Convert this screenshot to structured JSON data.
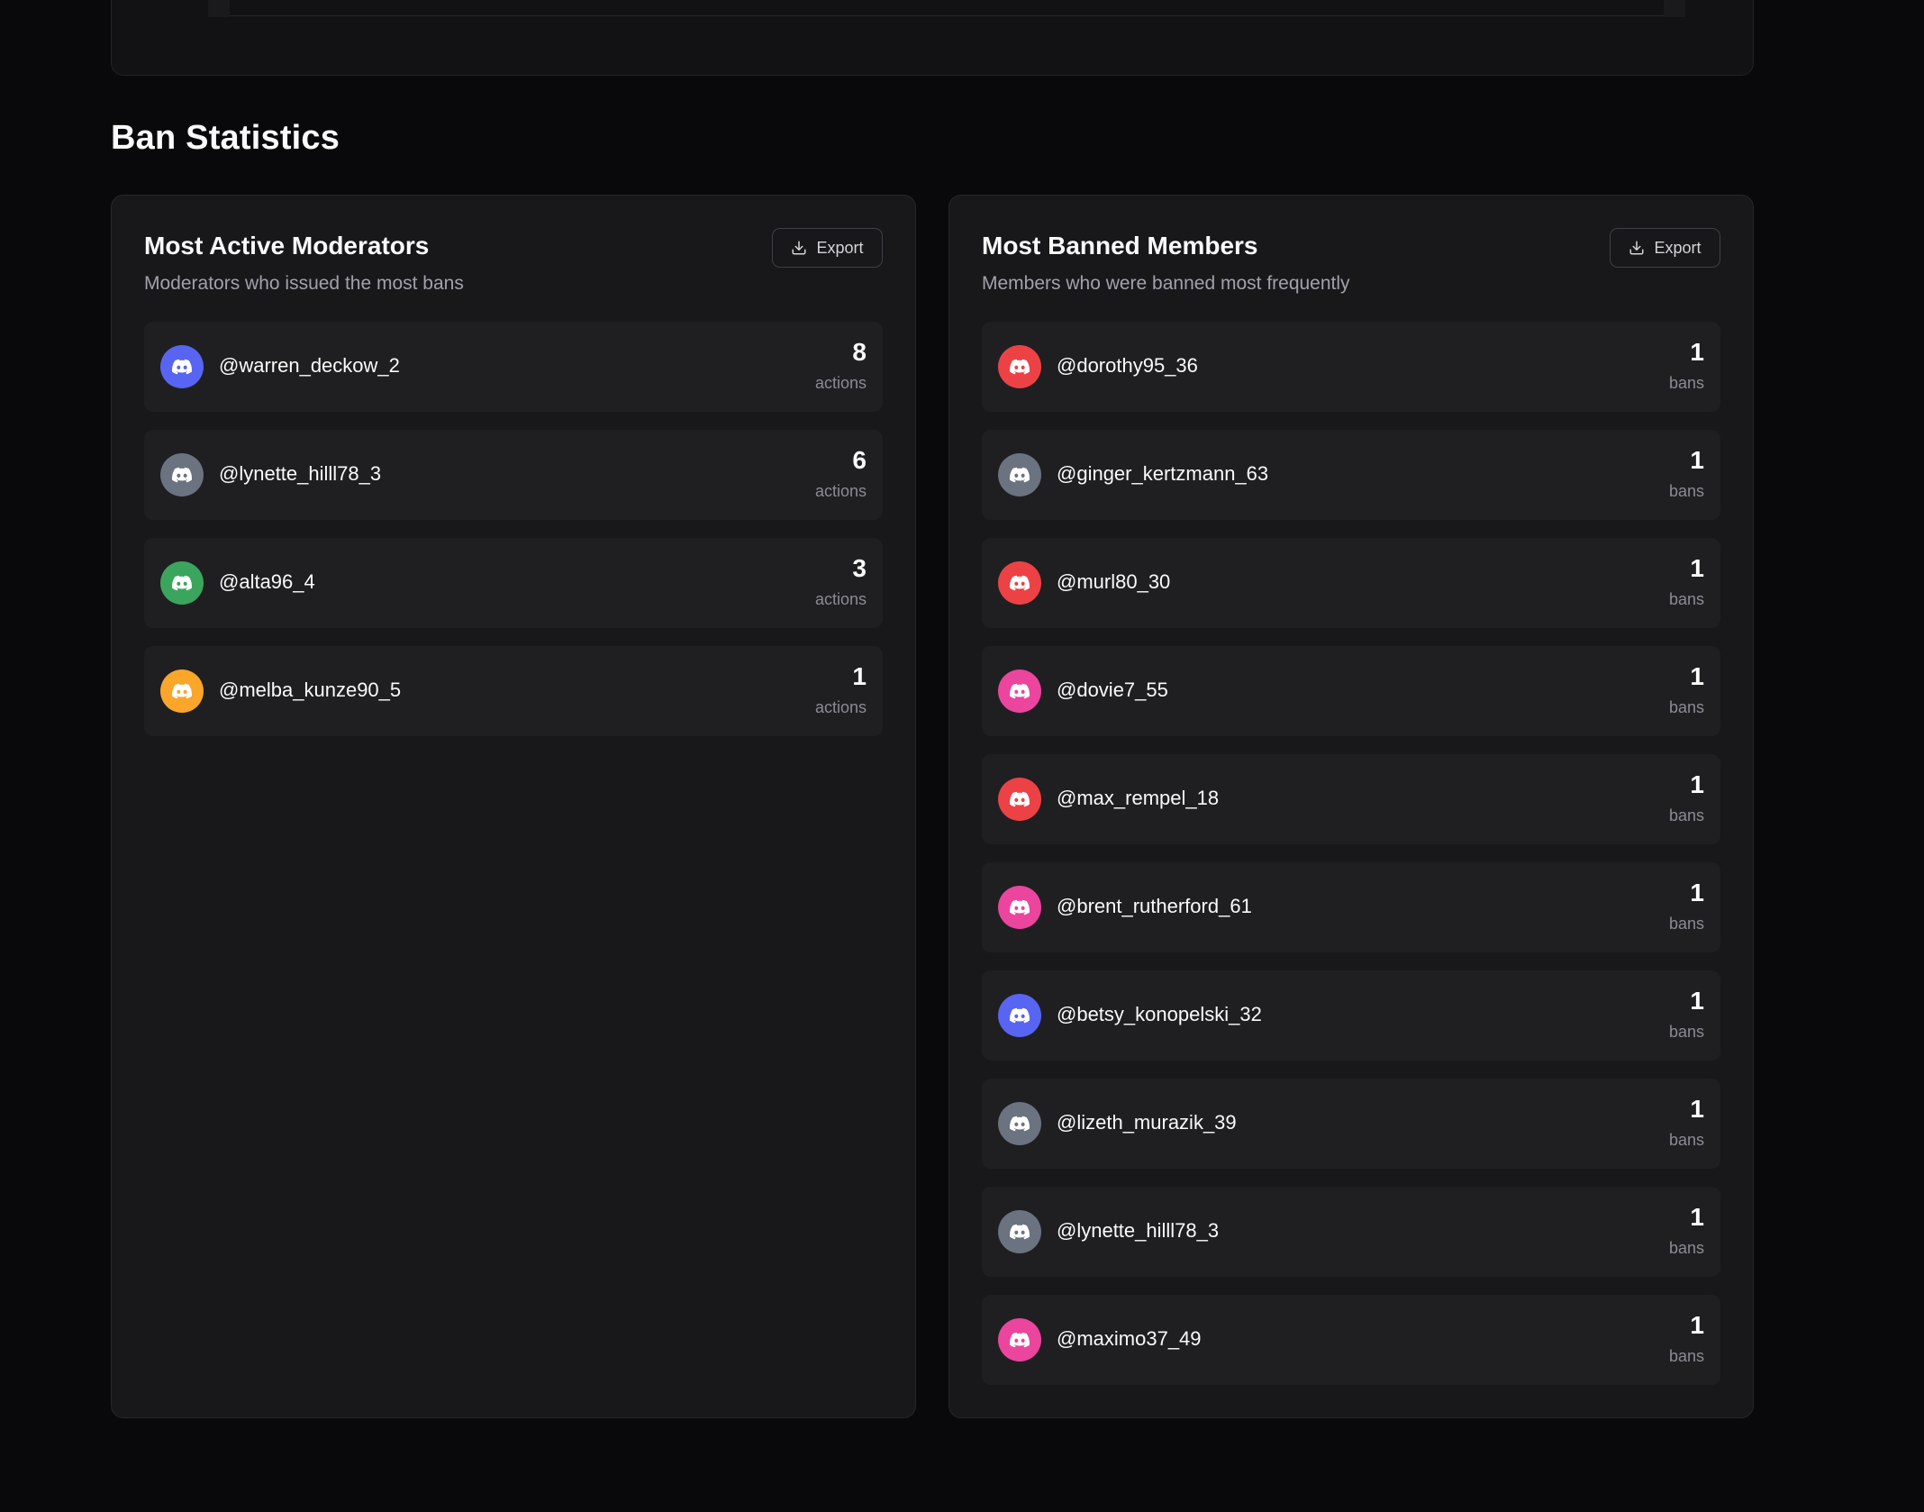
{
  "section": {
    "title": "Ban Statistics"
  },
  "moderators": {
    "title": "Most Active Moderators",
    "subtitle": "Moderators who issued the most bans",
    "export_label": "Export",
    "items": [
      {
        "username": "@warren_deckow_2",
        "count": "8",
        "unit": "actions",
        "avatar_color": "#5865f2"
      },
      {
        "username": "@lynette_hilll78_3",
        "count": "6",
        "unit": "actions",
        "avatar_color": "#6b7280"
      },
      {
        "username": "@alta96_4",
        "count": "3",
        "unit": "actions",
        "avatar_color": "#3ba55d"
      },
      {
        "username": "@melba_kunze90_5",
        "count": "1",
        "unit": "actions",
        "avatar_color": "#f9a62b"
      }
    ]
  },
  "banned": {
    "title": "Most Banned Members",
    "subtitle": "Members who were banned most frequently",
    "export_label": "Export",
    "items": [
      {
        "username": "@dorothy95_36",
        "count": "1",
        "unit": "bans",
        "avatar_color": "#ed4245"
      },
      {
        "username": "@ginger_kertzmann_63",
        "count": "1",
        "unit": "bans",
        "avatar_color": "#6b7280"
      },
      {
        "username": "@murl80_30",
        "count": "1",
        "unit": "bans",
        "avatar_color": "#ed4245"
      },
      {
        "username": "@dovie7_55",
        "count": "1",
        "unit": "bans",
        "avatar_color": "#eb459e"
      },
      {
        "username": "@max_rempel_18",
        "count": "1",
        "unit": "bans",
        "avatar_color": "#ed4245"
      },
      {
        "username": "@brent_rutherford_61",
        "count": "1",
        "unit": "bans",
        "avatar_color": "#eb459e"
      },
      {
        "username": "@betsy_konopelski_32",
        "count": "1",
        "unit": "bans",
        "avatar_color": "#5865f2"
      },
      {
        "username": "@lizeth_murazik_39",
        "count": "1",
        "unit": "bans",
        "avatar_color": "#6b7280"
      },
      {
        "username": "@lynette_hilll78_3",
        "count": "1",
        "unit": "bans",
        "avatar_color": "#6b7280"
      },
      {
        "username": "@maximo37_49",
        "count": "1",
        "unit": "bans",
        "avatar_color": "#eb459e"
      }
    ]
  }
}
